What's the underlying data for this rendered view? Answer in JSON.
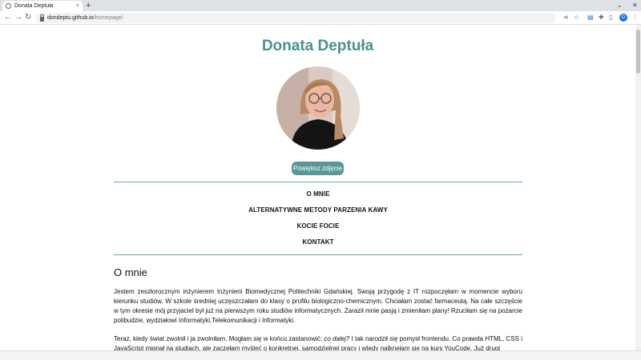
{
  "browser": {
    "tab_title": "Donata Deptuła",
    "tab_close": "×",
    "new_tab": "+",
    "url_host": "dondeptu.github.io",
    "url_path": "/homepage/",
    "profile_initial": "D"
  },
  "header": {
    "name": "Donata Deptuła"
  },
  "photo": {
    "enlarge_label": "Powiększ zdjęcie"
  },
  "nav": {
    "items": [
      "O MNIE",
      "ALTERNATYWNE METODY PARZENIA KAWY",
      "KOCIE FOCIE",
      "KONTAKT"
    ]
  },
  "about": {
    "heading": "O mnie",
    "p1": "Jestem zeszłorocznym inżynierem Inżynierii Biomedycznej Politechniki Gdańskiej. Swoją przygodę z IT rozpoczęłam w momencie wyboru kierunku studiów. W szkole średniej uczęszczałam do klasy o profilu biologiczno-chemicznym. Chciałam zostać farmaceutą. Na całe szczęście w tym okresie mój przyjaciel był już na pierwszym roku studiów informatycznych. Zaraził mnie pasją i zmieniłam plany! Rzuciłam się na pożarcie polibudzie, wydziałowi Informatyki,Telekomunikacji i Informatyki.",
    "p2_start": "Teraz, kiedy świat zwolnił i ja zwolniłam. Mogłam się w końcu zastanowić: ",
    "p2_em": "co dalej?",
    "p2_rest": " I tak narodził się pomysł frontendu. Co prawda HTML, CSS i JavaScript mignął na studiach, ale zaczęłam myśleć o konkretnej, samodzielnej pracy i wtedy natknęłam się na kurs YouCode. Już drugi"
  },
  "colors": {
    "accent": "#4a9191",
    "button": "#5a9898",
    "divider": "#6aa7a7"
  }
}
